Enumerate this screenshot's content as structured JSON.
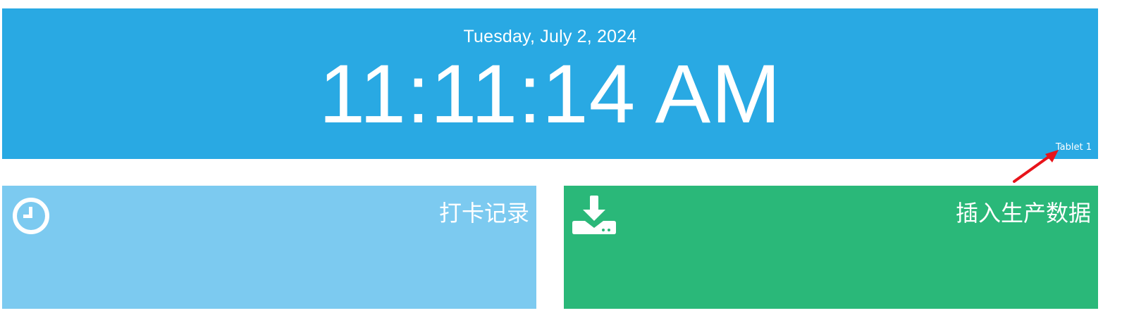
{
  "header": {
    "date": "Tuesday, July 2, 2024",
    "time": "11:11:14 AM",
    "device": "Tablet 1",
    "background": "#29a9e3"
  },
  "annotation": {
    "type": "arrow",
    "color": "#e8141a",
    "points_to": "device-label"
  },
  "tiles": [
    {
      "title": "打卡记录",
      "icon": "clock-icon",
      "background": "#7ccaf0"
    },
    {
      "title": "插入生产数据",
      "icon": "download-icon",
      "background": "#2ab879"
    }
  ]
}
